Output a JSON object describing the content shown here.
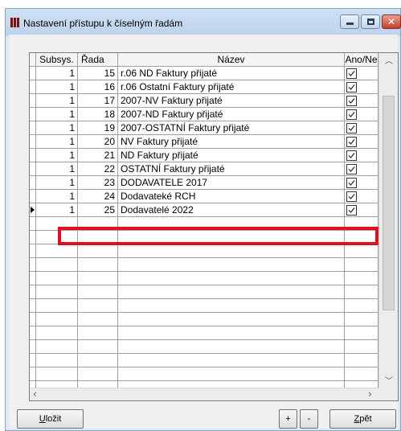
{
  "window": {
    "title": "Nastavení přístupu k číselným řadám",
    "minimize_icon": "minimize-icon",
    "maximize_icon": "maximize-icon",
    "close_icon": "close-icon"
  },
  "table": {
    "columns": [
      "Subsys.",
      "Řada",
      "Název",
      "Ano/Ne"
    ],
    "rows": [
      {
        "subsys": "1",
        "rada": "15",
        "nazev": "r.06 ND Faktury přijaté",
        "checked": true
      },
      {
        "subsys": "1",
        "rada": "16",
        "nazev": "r.06 Ostatní Faktury přijaté",
        "checked": true
      },
      {
        "subsys": "1",
        "rada": "17",
        "nazev": "2007-NV Faktury přijaté",
        "checked": true
      },
      {
        "subsys": "1",
        "rada": "18",
        "nazev": "2007-ND Faktury přijaté",
        "checked": true
      },
      {
        "subsys": "1",
        "rada": "19",
        "nazev": "2007-OSTATNÍ Faktury přijaté",
        "checked": true
      },
      {
        "subsys": "1",
        "rada": "20",
        "nazev": "NV Faktury přijaté",
        "checked": true
      },
      {
        "subsys": "1",
        "rada": "21",
        "nazev": "ND Faktury přijaté",
        "checked": true
      },
      {
        "subsys": "1",
        "rada": "22",
        "nazev": "OSTATNÍ Faktury přijaté",
        "checked": true
      },
      {
        "subsys": "1",
        "rada": "23",
        "nazev": "DODAVATELE 2017",
        "checked": true
      },
      {
        "subsys": "1",
        "rada": "24",
        "nazev": "Dodavateké RCH",
        "checked": true
      },
      {
        "subsys": "1",
        "rada": "25",
        "nazev": "Dodavatelé 2022",
        "checked": true
      }
    ],
    "selected_row": 10
  },
  "buttons": {
    "save": {
      "accel": "U",
      "rest": "ložit"
    },
    "plus": "+",
    "minus": "-",
    "back": {
      "accel": "Z",
      "rest": "pět"
    }
  },
  "colors": {
    "highlight": "#e01020",
    "titlebar": "#bcd2ec",
    "close_button": "#c2402a"
  }
}
